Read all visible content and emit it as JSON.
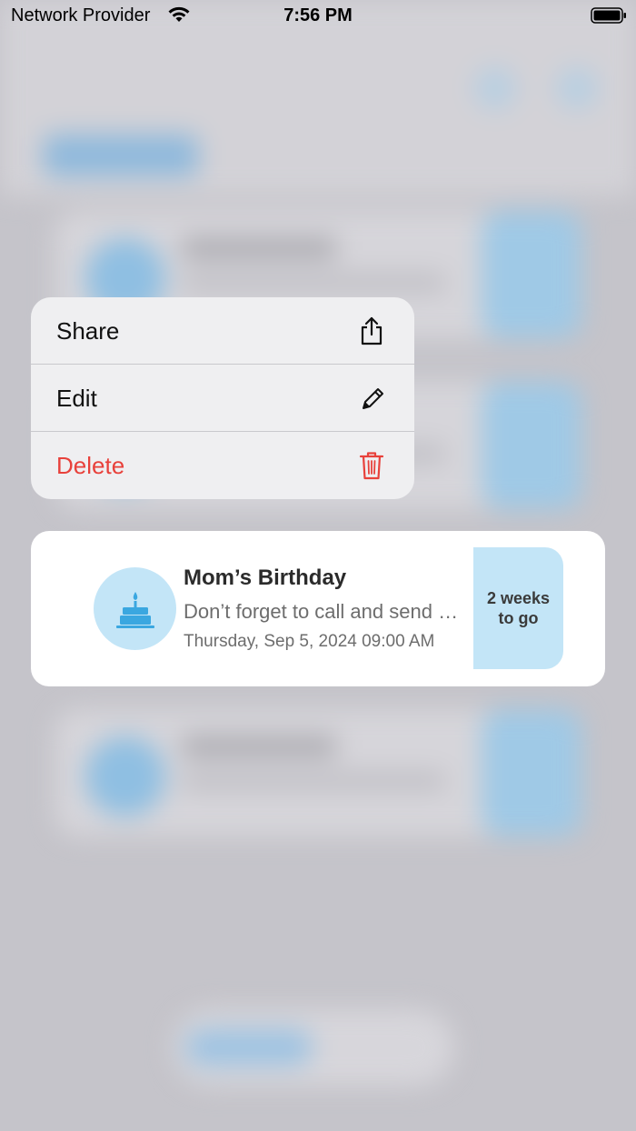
{
  "status_bar": {
    "carrier": "Network Provider",
    "time": "7:56 PM"
  },
  "context_menu": {
    "items": [
      {
        "label": "Share",
        "icon": "share-icon"
      },
      {
        "label": "Edit",
        "icon": "pencil-icon"
      },
      {
        "label": "Delete",
        "icon": "trash-icon",
        "color": "#e8413b"
      }
    ]
  },
  "event_card": {
    "icon": "birthday-cake-icon",
    "title": "Mom’s Birthday",
    "description": "Don’t forget to call and send a gift",
    "date": "Thursday, Sep 5, 2024 09:00 AM",
    "countdown": "2 weeks to go",
    "accent_color": "#3aa7e0"
  }
}
